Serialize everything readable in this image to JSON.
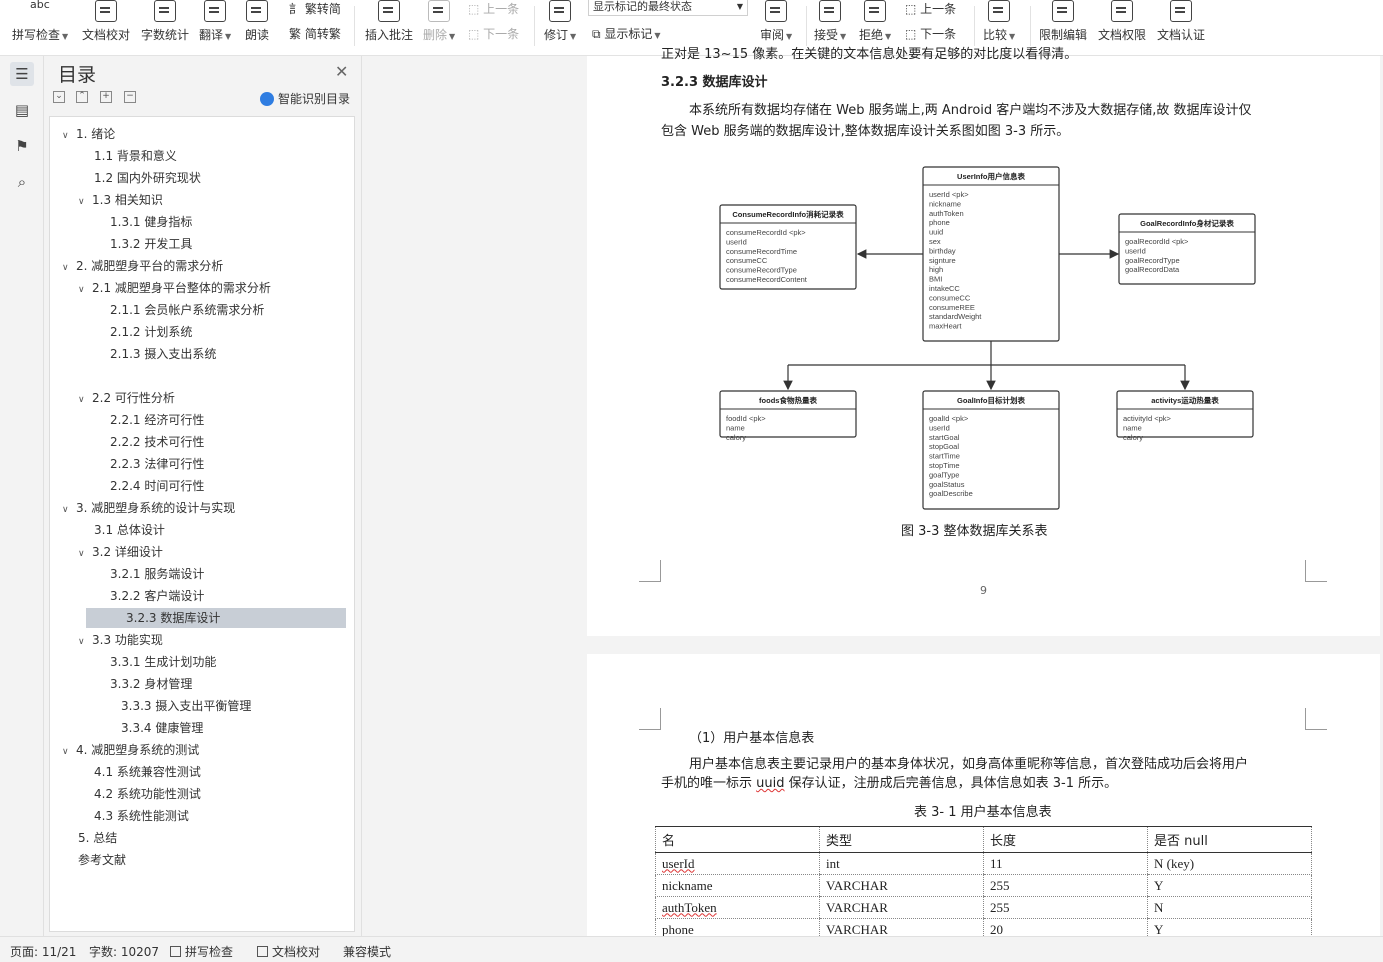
{
  "toolbar": {
    "spell_check": "拼写检查",
    "doc_check": "文档校对",
    "word_count": "字数统计",
    "translate": "翻译",
    "read_aloud": "朗读",
    "trad_to_simp": "繁转简",
    "simp_to_trad": "简转繁",
    "insert_comment": "插入批注",
    "delete": "删除",
    "prev": "上一条",
    "next": "下一条",
    "track": "修订",
    "markup_state": "显示标记的最终状态",
    "show_markup": "显示标记",
    "review": "审阅",
    "accept": "接受",
    "reject": "拒绝",
    "prev2": "上一条",
    "next2": "下一条",
    "compare": "比较",
    "restrict_edit": "限制编辑",
    "doc_perm": "文档权限",
    "doc_cert": "文档认证"
  },
  "toc": {
    "title": "目录",
    "smart": "智能识别目录",
    "items": [
      {
        "label": "1. 绪论"
      },
      {
        "label": "1.1 背景和意义"
      },
      {
        "label": "1.2 国内外研究现状"
      },
      {
        "label": "1.3 相关知识"
      },
      {
        "label": "1.3.1 健身指标"
      },
      {
        "label": "1.3.2 开发工具"
      },
      {
        "label": "2. 减肥塑身平台的需求分析"
      },
      {
        "label": "2.1 减肥塑身平台整体的需求分析"
      },
      {
        "label": "2.1.1 会员帐户系统需求分析"
      },
      {
        "label": "2.1.2 计划系统"
      },
      {
        "label": "2.1.3 摄入支出系统"
      },
      {
        "label": "2.2 可行性分析"
      },
      {
        "label": "2.2.1 经济可行性"
      },
      {
        "label": "2.2.2 技术可行性"
      },
      {
        "label": "2.2.3 法律可行性"
      },
      {
        "label": "2.2.4 时间可行性"
      },
      {
        "label": "3. 减肥塑身系统的设计与实现"
      },
      {
        "label": "3.1 总体设计"
      },
      {
        "label": "3.2 详细设计"
      },
      {
        "label": "3.2.1 服务端设计"
      },
      {
        "label": "3.2.2 客户端设计"
      },
      {
        "label": "3.2.3 数据库设计"
      },
      {
        "label": "3.3 功能实现"
      },
      {
        "label": "3.3.1 生成计划功能"
      },
      {
        "label": "3.3.2 身材管理"
      },
      {
        "label": "3.3.3 摄入支出平衡管理"
      },
      {
        "label": "3.3.4 健康管理"
      },
      {
        "label": "4. 减肥塑身系统的测试"
      },
      {
        "label": "4.1 系统兼容性测试"
      },
      {
        "label": "4.2 系统功能性测试"
      },
      {
        "label": "4.3 系统性能测试"
      },
      {
        "label": "5. 总结"
      },
      {
        "label": "参考文献"
      }
    ]
  },
  "page1": {
    "top_cut": "正对是 13~15 像素。在关键的文本信息处要有足够的对比度以看得清。",
    "heading": "3.2.3 数据库设计",
    "para_line1": "本系统所有数据均存储在 Web 服务端上,两 Android 客户端均不涉及大数据存储,故 数据库设计仅",
    "para_line2": "包含 Web 服务端的数据库设计,整体数据库设计关系图如图 3-3 所示。",
    "caption": "图 3-3  整体数据库关系表",
    "page_number": "9"
  },
  "erd": {
    "user": {
      "title": "UserInfo用户信息表",
      "fields": [
        "userId    <pk>",
        "nickname",
        "authToken",
        "phone",
        "uuid",
        "sex",
        "birthday",
        "signture",
        "high",
        "BMI",
        "intakeCC",
        "consumeCC",
        "consumeREE",
        "standardWeight",
        "maxHeart"
      ]
    },
    "consume": {
      "title": "ConsumeRecordInfo消耗记录表",
      "fields": [
        "consumeRecordId    <pk>",
        "userId",
        "consumeRecordTime",
        "consumeCC",
        "consumeRecordType",
        "consumeRecordContent"
      ]
    },
    "goalrec": {
      "title": "GoalRecordInfo身材记录表",
      "fields": [
        "goalRecordId    <pk>",
        "userId",
        "goalRecordType",
        "goalRecordData"
      ]
    },
    "foods": {
      "title": "foods食物热量表",
      "fields": [
        "foodId    <pk>",
        "name",
        "calory"
      ]
    },
    "goal": {
      "title": "GoalInfo目标计划表",
      "fields": [
        "goalId    <pk>",
        "userId",
        "startGoal",
        "stopGoal",
        "startTime",
        "stopTime",
        "goalType",
        "goalStatus",
        "goalDescribe"
      ]
    },
    "activity": {
      "title": "activitys运动热量表",
      "fields": [
        "activityId    <pk>",
        "name",
        "calory"
      ]
    }
  },
  "page2": {
    "sub": "（1）用户基本信息表",
    "para_line1": "用户基本信息表主要记录用户的基本身体状况，如身高体重昵称等信息，首次登陆成功后会将用户",
    "para_line2_a": "手机的唯一标示 ",
    "para_line2_b": "uuid",
    "para_line2_c": " 保存认证，注册成后完善信息，具体信息如表 3-1 所示。",
    "table_caption": "表 3- 1 用户基本信息表",
    "table": {
      "headers": [
        "名",
        "类型",
        "长度",
        "是否 null"
      ],
      "rows": [
        [
          "userId",
          "int",
          "11",
          "N (key)"
        ],
        [
          "nickname",
          "VARCHAR",
          "255",
          "Y"
        ],
        [
          "authToken",
          "VARCHAR",
          "255",
          "N"
        ],
        [
          "phone",
          "VARCHAR",
          "20",
          "Y"
        ]
      ]
    }
  },
  "status": {
    "page": "页面: 11/21",
    "words": "字数: 10207",
    "spell": "拼写检查",
    "doccheck": "文档校对",
    "compat": "兼容模式"
  }
}
